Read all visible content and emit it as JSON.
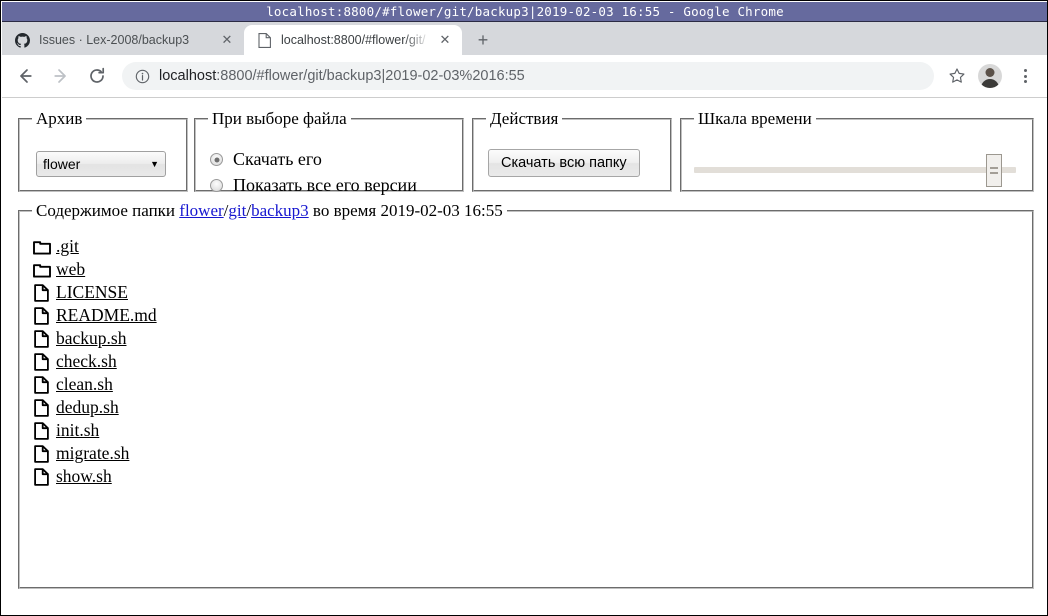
{
  "window": {
    "title": "localhost:8800/#flower/git/backup3|2019-02-03 16:55 - Google Chrome"
  },
  "browser": {
    "tabs": [
      {
        "title": "Issues · Lex-2008/backup3",
        "favicon": "github-icon",
        "active": false,
        "close_label": "✕"
      },
      {
        "title": "localhost:8800/#flower/git/",
        "favicon": "page-icon",
        "active": true,
        "close_label": "✕"
      }
    ],
    "new_tab_label": "+",
    "toolbar": {
      "back_label": "←",
      "forward_label": "→",
      "reload_label": "⟳",
      "info_label": "ⓘ",
      "url_host": "localhost",
      "url_rest": ":8800/#flower/git/backup3|2019-02-03%2016:55",
      "bookmark_label": "☆",
      "menu_label": "⋮"
    }
  },
  "app": {
    "archive": {
      "legend": "Архив",
      "select_value": "flower",
      "select_arrow": "▼"
    },
    "on_file_select": {
      "legend": "При выборе файла",
      "options": [
        {
          "label": "Скачать его",
          "checked": true
        },
        {
          "label": "Показать все его версии",
          "checked": false
        }
      ]
    },
    "actions": {
      "legend": "Действия",
      "download_folder_label": "Скачать всю папку"
    },
    "timeline": {
      "legend": "Шкала времени",
      "slider_position_percent": 96
    },
    "content": {
      "legend_prefix": "Содержимое папки ",
      "breadcrumb": [
        {
          "label": "flower",
          "link": true
        },
        {
          "label": "/",
          "link": false
        },
        {
          "label": "git",
          "link": true
        },
        {
          "label": "/",
          "link": false
        },
        {
          "label": "backup3",
          "link": true
        }
      ],
      "legend_suffix": " во время 2019-02-03 16:55",
      "entries": [
        {
          "name": ".git",
          "type": "folder"
        },
        {
          "name": "web",
          "type": "folder"
        },
        {
          "name": "LICENSE",
          "type": "file"
        },
        {
          "name": "README.md",
          "type": "file"
        },
        {
          "name": "backup.sh",
          "type": "file"
        },
        {
          "name": "check.sh",
          "type": "file"
        },
        {
          "name": "clean.sh",
          "type": "file"
        },
        {
          "name": "dedup.sh",
          "type": "file"
        },
        {
          "name": "init.sh",
          "type": "file"
        },
        {
          "name": "migrate.sh",
          "type": "file"
        },
        {
          "name": "show.sh",
          "type": "file"
        }
      ]
    }
  },
  "colors": {
    "titlebar_bg": "#666a9e",
    "link": "#1616d0",
    "tabstrip_bg": "#d6d8dc",
    "omnibox_bg": "#f1f3f4"
  }
}
